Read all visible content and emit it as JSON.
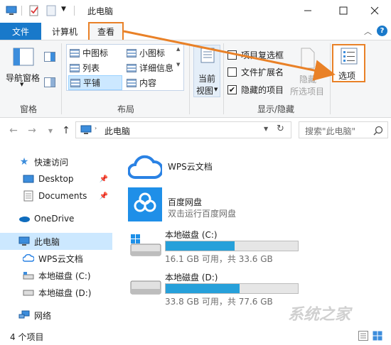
{
  "window": {
    "title": "此电脑",
    "minimize_icon": "minimize-icon",
    "maximize_icon": "maximize-icon",
    "close_icon": "close-icon"
  },
  "tabs": {
    "file": "文件",
    "computer": "计算机",
    "view": "查看"
  },
  "ribbon": {
    "pane_group": {
      "nav_pane": "导航窗格",
      "label": "窗格"
    },
    "layout_group": {
      "items": [
        "中图标",
        "小图标",
        "列表",
        "详细信息",
        "平铺",
        "内容"
      ],
      "label": "布局"
    },
    "current_view": {
      "line1": "当前",
      "line2": "视图"
    },
    "show_hide_group": {
      "item_checkboxes": "项目复选框",
      "file_ext": "文件扩展名",
      "hidden_items": "隐藏的项目",
      "hide_line1": "隐藏",
      "hide_line2": "所选项目",
      "label": "显示/隐藏",
      "item_checkboxes_checked": false,
      "file_ext_checked": false,
      "hidden_items_checked": true
    },
    "options": "选项"
  },
  "address": {
    "path": "此电脑",
    "search_placeholder": "搜索\"此电脑\""
  },
  "nav": {
    "quick_access": "快速访问",
    "desktop": "Desktop",
    "documents": "Documents",
    "onedrive": "OneDrive",
    "this_pc": "此电脑",
    "wps": "WPS云文档",
    "drive_c": "本地磁盘 (C:)",
    "drive_d": "本地磁盘 (D:)",
    "network": "网络"
  },
  "content": {
    "wps": {
      "name": "WPS云文档"
    },
    "baidu": {
      "name": "百度网盘",
      "desc": "双击运行百度网盘"
    },
    "drive_c": {
      "name": "本地磁盘 (C:)",
      "usage": "16.1 GB 可用，共 33.6 GB",
      "used_fraction": 0.52
    },
    "drive_d": {
      "name": "本地磁盘 (D:)",
      "usage": "33.8 GB 可用，共 77.6 GB",
      "used_fraction": 0.56
    }
  },
  "status": {
    "count": "4 个项目"
  },
  "watermark": "系统之家",
  "colors": {
    "accent": "#1979ca",
    "annotation": "#e98127",
    "drive_fill": "#26a0da",
    "selection": "#cce8ff"
  }
}
